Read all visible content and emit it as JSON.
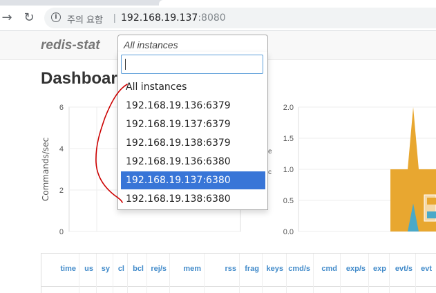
{
  "browser": {
    "security_label": "주의 요함",
    "url_host": "192.168.19.137",
    "url_port": ":8080",
    "back_icon": "back-arrow-icon",
    "reload_icon": "reload-icon",
    "info_icon": "info-icon"
  },
  "app": {
    "brand": "redis-stat",
    "instance_select": "All instances",
    "page_title": "Dashboard"
  },
  "dropdown": {
    "options": [
      "All instances",
      "192.168.19.136:6379",
      "192.168.19.137:6379",
      "192.168.19.138:6379",
      "192.168.19.136:6380",
      "192.168.19.137:6380",
      "192.168.19.138:6380"
    ],
    "selected_index": 5,
    "highlight_color": "#3875d7"
  },
  "chart_data": [
    {
      "type": "line",
      "ylabel": "Commands/sec",
      "ylim": [
        0,
        6
      ],
      "y_ticks": [
        "6",
        "4",
        "2",
        "0"
      ],
      "series": []
    },
    {
      "type": "area",
      "ylim": [
        0,
        2.0
      ],
      "y_ticks": [
        "2.0",
        "1.5",
        "1.0",
        "0.5",
        "0.0"
      ],
      "series": [
        {
          "color": "#e8a730",
          "values": [
            1.0,
            1.0,
            2.0,
            1.0,
            1.0
          ]
        },
        {
          "color": "#4aa9c8",
          "values": [
            0.0,
            0.0,
            0.45,
            0.0,
            0.0
          ]
        }
      ]
    }
  ],
  "table": {
    "headers": [
      "time",
      "us",
      "sy",
      "cl",
      "bcl",
      "rej/s",
      "mem",
      "rss",
      "frag",
      "keys",
      "cmd/s",
      "cmd",
      "exp/s",
      "exp",
      "evt/s",
      "evt"
    ]
  },
  "colors": {
    "annotation": "#cc0000",
    "header_link": "#428bca"
  }
}
